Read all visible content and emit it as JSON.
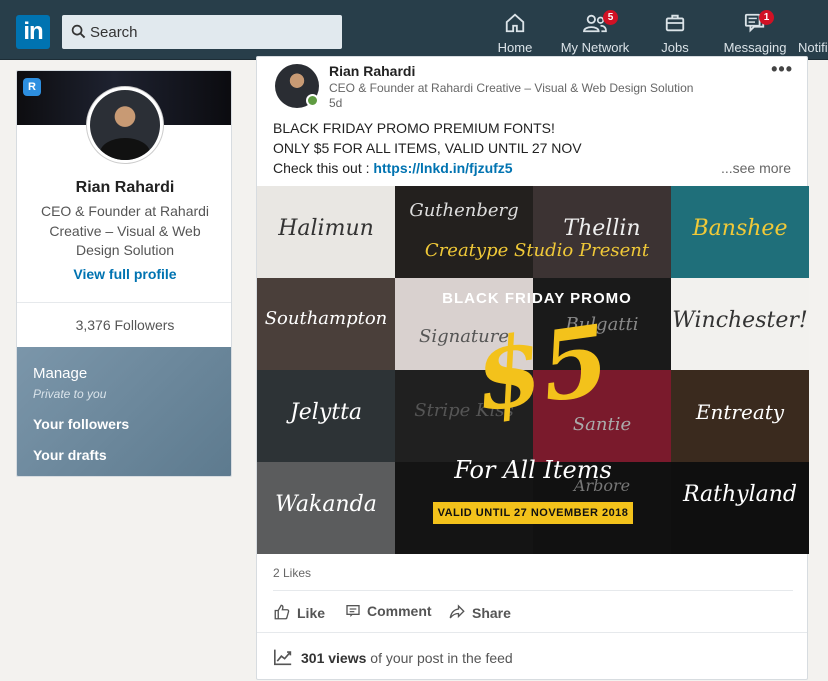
{
  "nav": {
    "logo": "in",
    "search_placeholder": "Search",
    "items": [
      {
        "label": "Home",
        "icon": "home-icon"
      },
      {
        "label": "My Network",
        "icon": "network-icon",
        "badge": "5"
      },
      {
        "label": "Jobs",
        "icon": "jobs-icon"
      },
      {
        "label": "Messaging",
        "icon": "messaging-icon",
        "badge": "1"
      },
      {
        "label": "Notifi",
        "icon": "notifications-icon"
      }
    ]
  },
  "profile": {
    "name": "Rian Rahardi",
    "headline": "CEO & Founder at Rahardi Creative – Visual & Web Design Solution",
    "view_profile": "View full profile",
    "followers": "3,376 Followers",
    "manage": {
      "title": "Manage",
      "subtitle": "Private to you",
      "links": [
        "Your followers",
        "Your drafts"
      ]
    }
  },
  "post": {
    "author": "Rian Rahardi",
    "headline": "CEO & Founder at Rahardi Creative – Visual & Web Design Solution",
    "time": "5d",
    "more": "•••",
    "lines": [
      "BLACK FRIDAY PROMO PREMIUM FONTS!",
      "ONLY $5 FOR ALL ITEMS, VALID UNTIL 27 NOV"
    ],
    "link_prefix": "Check this out : ",
    "link_text": "https://lnkd.in/fjzufz5",
    "see_more": "...see more",
    "image": {
      "title": "BLACK FRIDAY PROMO",
      "price": "$5",
      "subtitle": "For All Items",
      "valid": "VALID UNTIL 27 NOVEMBER 2018",
      "fonts": [
        "Halimun",
        "Guthenberg",
        "Thellin",
        "Banshee",
        "Southampton",
        "Signature",
        "Bulgatti",
        "Winchester!",
        "Jelytta",
        "Stripe Kiss",
        "Santie",
        "Entreaty",
        "Wakanda",
        "",
        "Arbore",
        "Rathyland"
      ],
      "banner_text": "Creatype Studio Present"
    },
    "likes": "2 Likes",
    "actions": [
      "Like",
      "Comment",
      "Share"
    ],
    "views_count": "301 views",
    "views_suffix": " of your post in the feed"
  },
  "colors": {
    "nav_bg": "#283e4a",
    "link_blue": "#0073b1",
    "badge_red": "#d11124",
    "promo_yellow": "#f3c21b",
    "online_green": "#5f9b41"
  }
}
